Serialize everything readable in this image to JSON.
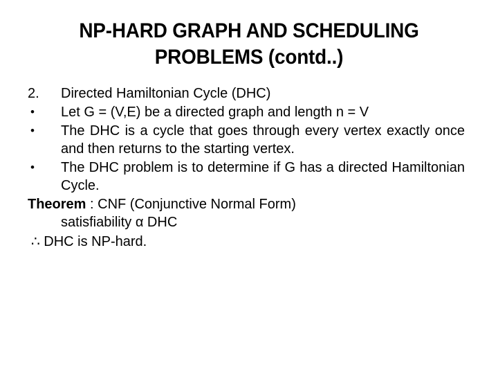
{
  "slide": {
    "background_color": "#ffffff",
    "text_color": "#000000",
    "title": {
      "line1": "NP-HARD GRAPH AND SCHEDULING",
      "line2": "PROBLEMS (contd..)"
    },
    "body": {
      "items": [
        {
          "marker": "2.",
          "marker_type": "number",
          "text": "Directed Hamiltonian Cycle (DHC)",
          "justified": false
        },
        {
          "marker": "•",
          "marker_type": "bullet",
          "text": "Let G = (V,E) be a directed graph and length n = V",
          "justified": false
        },
        {
          "marker": "•",
          "marker_type": "bullet",
          "text": "The DHC is a cycle that goes through every vertex exactly once and then returns to the starting vertex.",
          "justified": true
        },
        {
          "marker": "•",
          "marker_type": "bullet",
          "text": "The DHC problem is to determine if G has a directed Hamiltonian Cycle.",
          "justified": true
        }
      ],
      "theorem": {
        "lead": "Theorem",
        "statement": " :  CNF  (Conjunctive   Normal   Form)",
        "continuation": "satisfiability α DHC"
      },
      "conclusion": "∴ DHC is NP-hard."
    }
  }
}
